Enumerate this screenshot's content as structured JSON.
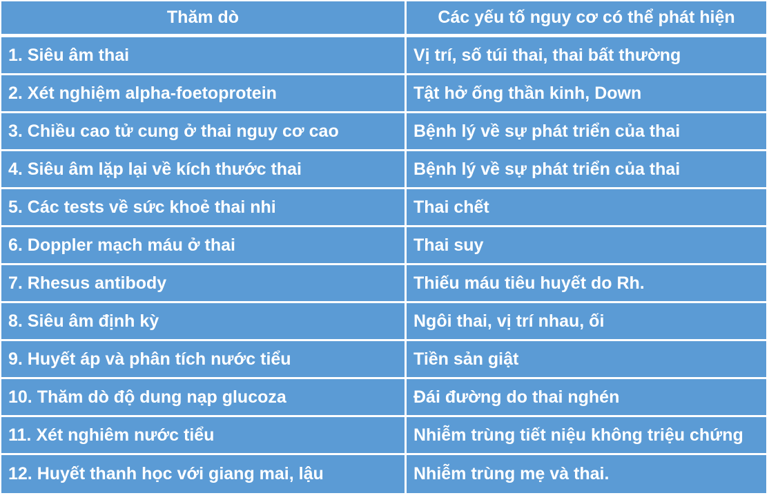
{
  "table": {
    "headers": [
      "Thăm dò",
      "Các yếu tố nguy cơ có thể phát hiện"
    ],
    "rows": [
      [
        "1. Siêu âm thai",
        "Vị trí, số túi thai, thai bất thường"
      ],
      [
        "2. Xét nghiệm alpha-foetoprotein",
        "Tật hở ống thần kinh, Down"
      ],
      [
        "3. Chiều cao tử cung ở thai nguy cơ cao",
        "Bệnh lý về sự phát triển của thai"
      ],
      [
        "4. Siêu âm lặp lại về kích thước thai",
        "Bệnh lý về sự phát triển của thai"
      ],
      [
        "5. Các tests về sức khoẻ thai nhi",
        "Thai chết"
      ],
      [
        "6. Doppler mạch máu ở thai",
        "Thai suy"
      ],
      [
        "7. Rhesus antibody",
        "Thiếu máu tiêu huyết do Rh."
      ],
      [
        "8. Siêu âm định kỳ",
        "Ngôi thai, vị trí nhau, ối"
      ],
      [
        "9.  Huyết áp và phân tích nước tiểu",
        "Tiền sản giật"
      ],
      [
        "10. Thăm dò độ dung nạp glucoza",
        "Đái đường do thai nghén"
      ],
      [
        "11. Xét nghiêm nước tiểu",
        "Nhiễm trùng tiết niệu không triệu chứng"
      ],
      [
        "12. Huyết thanh học với giang mai, lậu",
        "Nhiễm trùng mẹ và thai."
      ]
    ]
  },
  "colors": {
    "cell_bg": "#5B9BD5",
    "text": "#FFFFFF",
    "border": "#FFFFFF"
  }
}
